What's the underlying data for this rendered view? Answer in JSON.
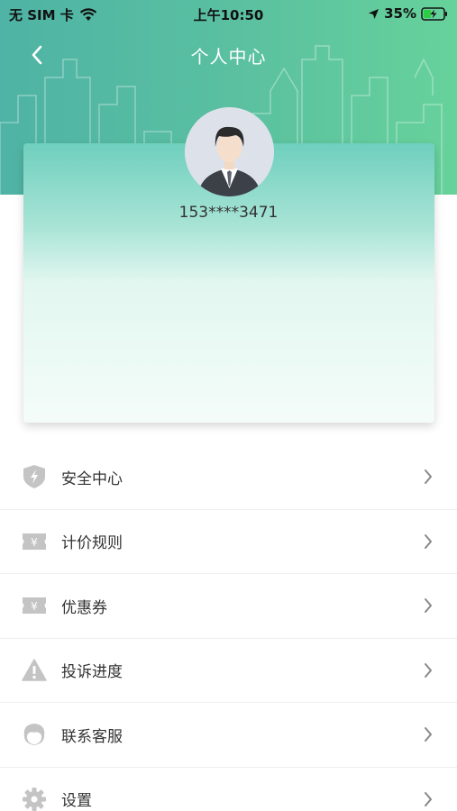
{
  "status_bar": {
    "carrier": "无 SIM 卡",
    "time": "上午10:50",
    "battery": "35%"
  },
  "nav": {
    "title": "个人中心"
  },
  "profile": {
    "phone": "153****3471"
  },
  "menu": [
    {
      "label": "安全中心",
      "icon": "shield-icon"
    },
    {
      "label": "计价规则",
      "icon": "yen-ticket-icon"
    },
    {
      "label": "优惠券",
      "icon": "coupon-icon"
    },
    {
      "label": "投诉进度",
      "icon": "warning-icon"
    },
    {
      "label": "联系客服",
      "icon": "customer-service-icon"
    },
    {
      "label": "设置",
      "icon": "gear-icon"
    }
  ],
  "colors": {
    "header_start": "#4fb3a5",
    "header_end": "#67d29b",
    "icon_gray": "#c4c4c4"
  }
}
